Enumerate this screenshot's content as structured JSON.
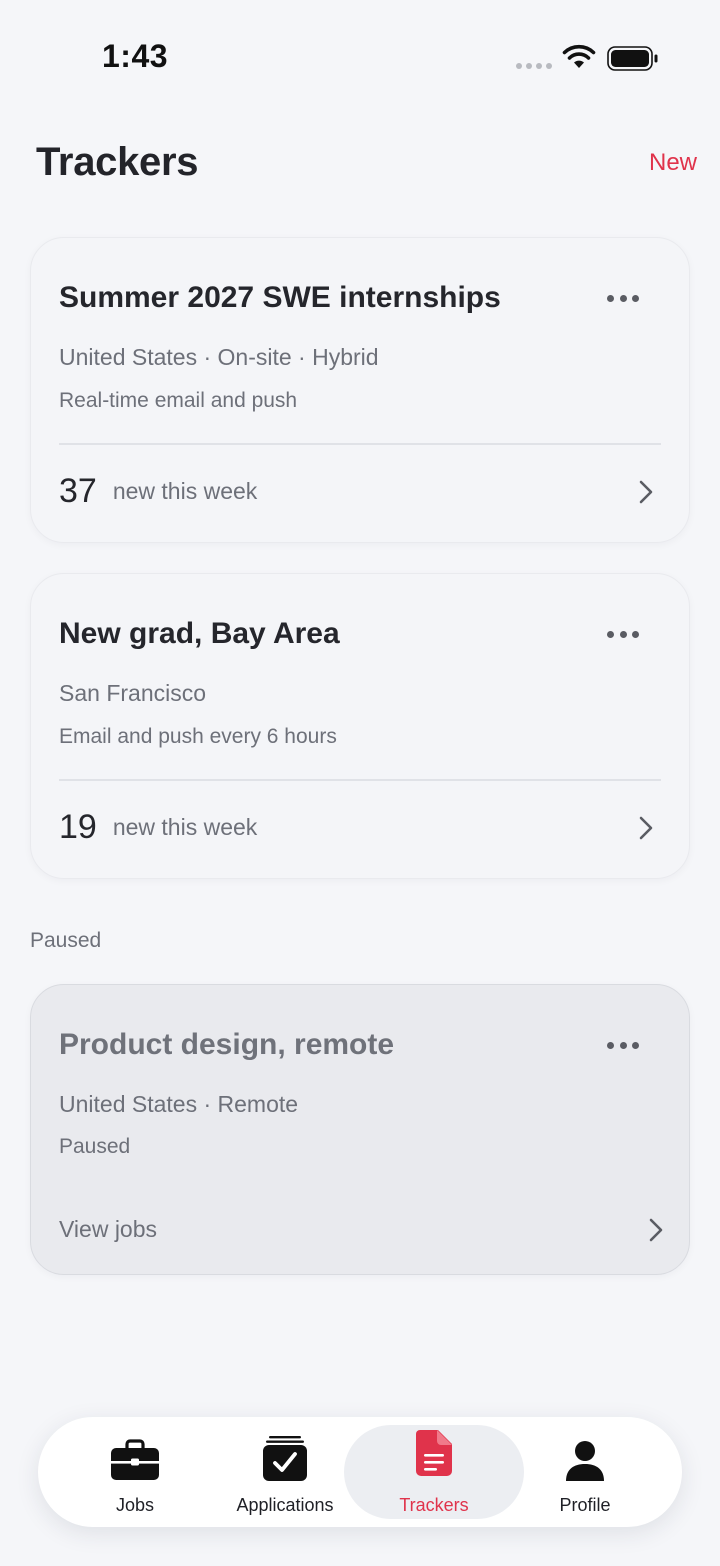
{
  "status_bar": {
    "time": "1:43"
  },
  "header": {
    "title": "Trackers",
    "new_label": "New"
  },
  "trackers": [
    {
      "title": "Summer 2027 SWE internships",
      "meta": "United States · On-site · Hybrid",
      "note": "Real-time email and push",
      "count": "37",
      "count_label": "new this week"
    },
    {
      "title": "New grad, Bay Area",
      "meta": "San Francisco",
      "note": "Email and push every 6 hours",
      "count": "19",
      "count_label": "new this week"
    }
  ],
  "paused_section": {
    "label": "Paused",
    "tracker": {
      "title": "Product design, remote",
      "meta": "United States · Remote",
      "note": "Paused",
      "action": "View jobs"
    }
  },
  "tab_bar": {
    "active": "Trackers",
    "tabs": [
      {
        "label": "Jobs",
        "icon": "briefcase-icon"
      },
      {
        "label": "Applications",
        "icon": "checklist-icon"
      },
      {
        "label": "Trackers",
        "icon": "document-icon"
      },
      {
        "label": "Profile",
        "icon": "person-icon"
      }
    ]
  },
  "colors": {
    "accent": "#e0334b",
    "background": "#f5f6f9"
  }
}
